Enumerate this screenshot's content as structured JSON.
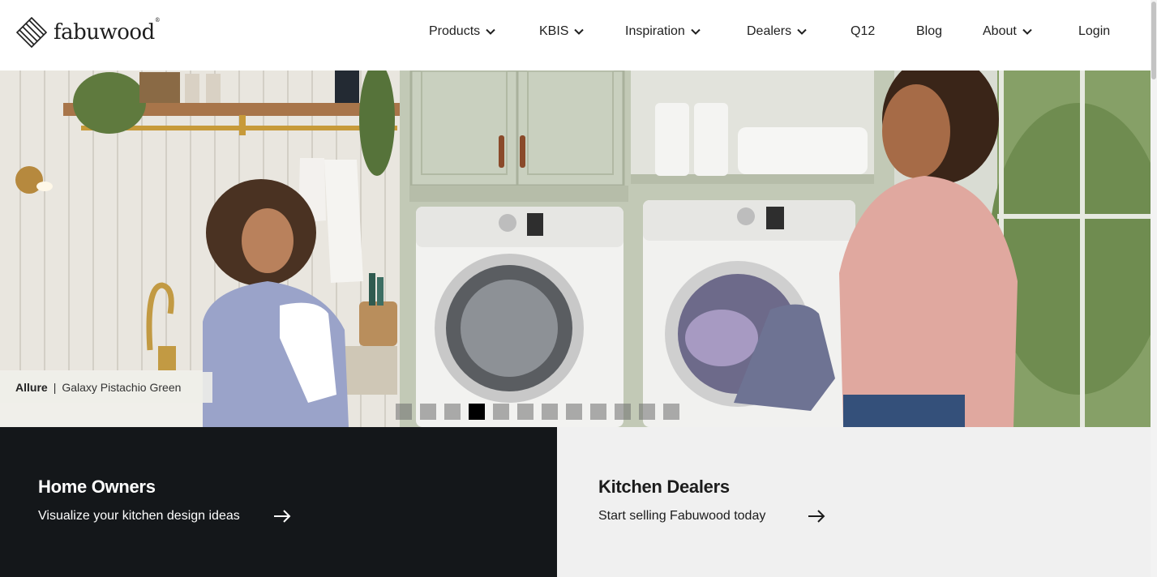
{
  "brand": {
    "name": "fabuwood",
    "registered": "®"
  },
  "nav": {
    "items": [
      {
        "label": "Products",
        "dropdown": true
      },
      {
        "label": "KBIS",
        "dropdown": true
      },
      {
        "label": "Inspiration",
        "dropdown": true
      },
      {
        "label": "Dealers",
        "dropdown": true
      },
      {
        "label": "Q12",
        "dropdown": false
      },
      {
        "label": "Blog",
        "dropdown": false
      },
      {
        "label": "About",
        "dropdown": true
      },
      {
        "label": "Login",
        "dropdown": false
      }
    ]
  },
  "hero": {
    "caption": {
      "collection": "Allure",
      "separator": "|",
      "finish": "Galaxy Pistachio Green"
    },
    "slides_total": 12,
    "active_slide": 3
  },
  "panels": {
    "home_owners": {
      "title": "Home Owners",
      "link": "Visualize your kitchen design ideas"
    },
    "kitchen_dealers": {
      "title": "Kitchen Dealers",
      "link": "Start selling Fabuwood today"
    }
  },
  "colors": {
    "dark_panel": "#14171a",
    "light_panel": "#f0f0f0",
    "text": "#1f1f1f",
    "active_dot": "#000000"
  }
}
